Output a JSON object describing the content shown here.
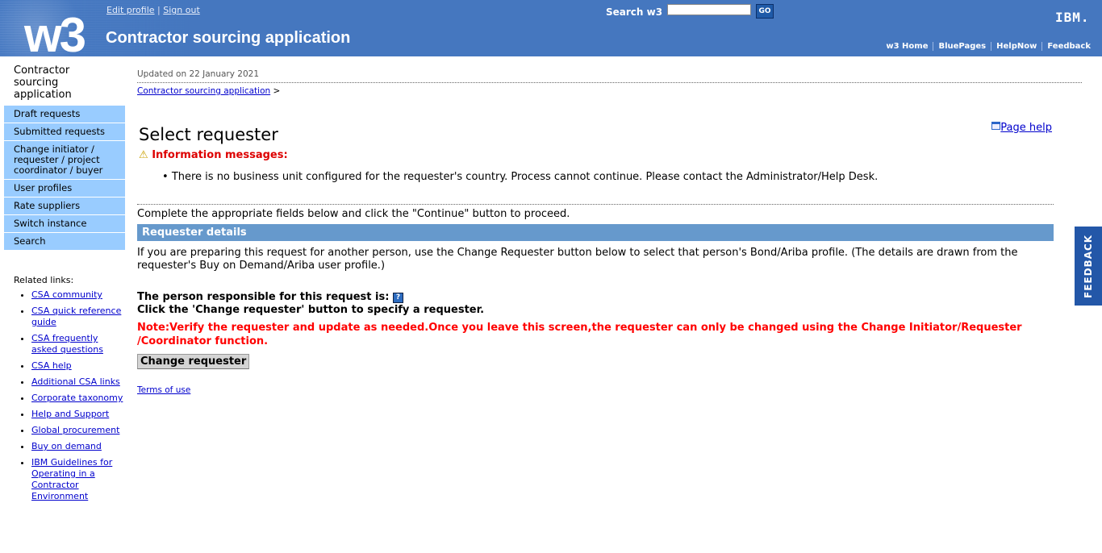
{
  "header": {
    "logo": "w3",
    "edit_profile": "Edit profile",
    "separator": "|",
    "sign_out": "Sign out",
    "app_title": "Contractor sourcing application",
    "search_label": "Search w3",
    "search_value": "",
    "go": "GO",
    "brand": "IBM.",
    "nav": [
      "w3 Home",
      "BluePages",
      "HelpNow",
      "Feedback"
    ]
  },
  "sidebar": {
    "title": "Contractor sourcing application",
    "items": [
      "Draft requests",
      "Submitted requests",
      "Change initiator / requester / project coordinator / buyer",
      "User profiles",
      "Rate suppliers",
      "Switch instance",
      "Search"
    ],
    "related_title": "Related links:",
    "related": [
      "CSA community",
      "CSA quick reference guide",
      "CSA frequently asked questions",
      "CSA help",
      "Additional CSA links",
      "Corporate taxonomy",
      "Help and Support",
      "Global procurement",
      "Buy on demand",
      "IBM Guidelines for Operating in a Contractor Environment"
    ]
  },
  "main": {
    "updated": "Updated on 22 January 2021",
    "breadcrumb": "Contractor sourcing application",
    "breadcrumb_sep": ">",
    "title": "Select requester",
    "page_help": "Page help",
    "info_header": "Information messages:",
    "message": "There is no business unit configured for the requester's country. Process cannot continue. Please contact the Administrator/Help Desk.",
    "instructions": "Complete the appropriate fields below and click the \"Continue\" button to proceed.",
    "section": "Requester details",
    "description": "If you are preparing this request for another person, use the Change Requester button below to select that person's Bond/Ariba profile. (The details are drawn from the requester's Buy on Demand/Ariba user profile.)",
    "responsible": "The person responsible for this request is:",
    "help_icon": "?",
    "click_change": "Click the 'Change requester' button to specify a requester.",
    "note": "Note:Verify the requester and update as needed.Once you leave this screen,the requester can only be changed using the Change Initiator/Requester /Coordinator function.",
    "change_button": "Change requester",
    "terms": "Terms of use"
  },
  "feedback_tab": "FEEDBACK"
}
